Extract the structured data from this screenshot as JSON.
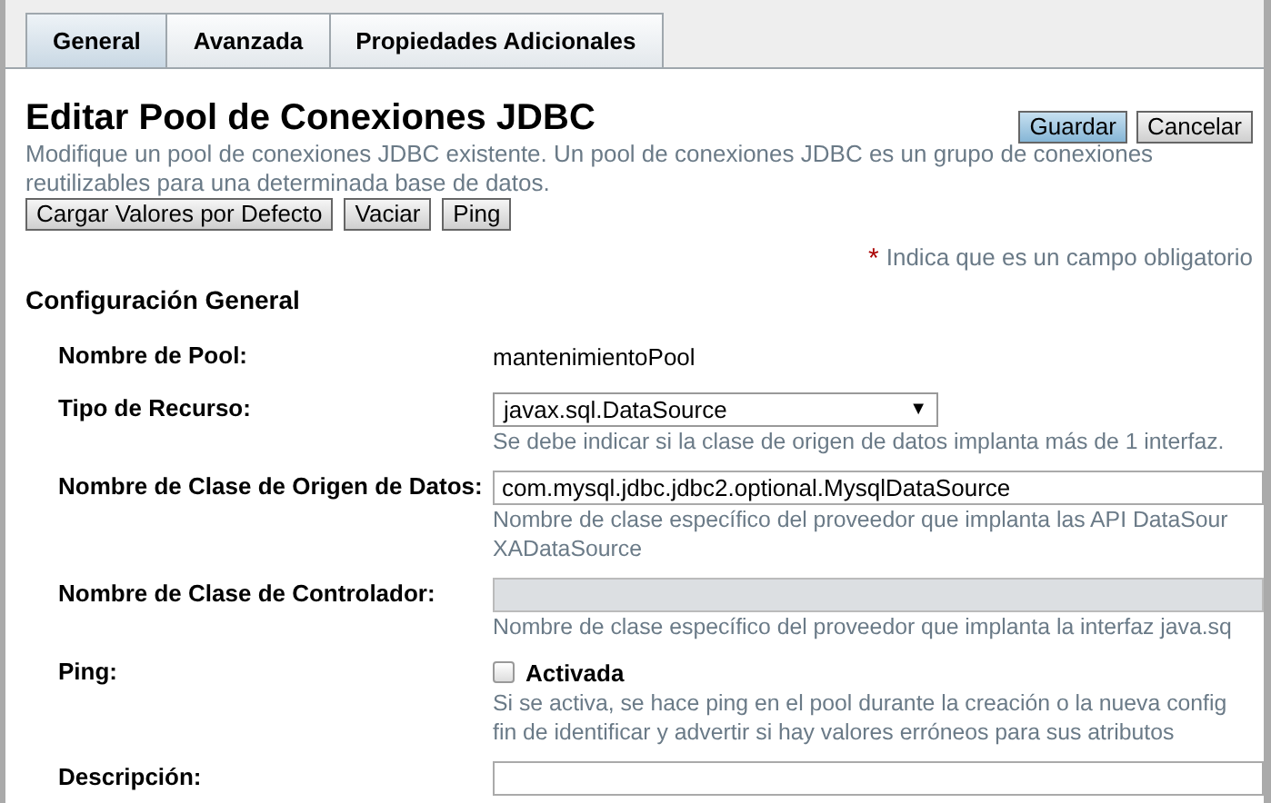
{
  "tabs": [
    {
      "label": "General",
      "selected": true
    },
    {
      "label": "Avanzada",
      "selected": false
    },
    {
      "label": "Propiedades Adicionales",
      "selected": false
    }
  ],
  "title": "Editar Pool de Conexiones JDBC",
  "description_lines": [
    "Modifique un pool de conexiones JDBC existente. Un pool de conexiones JDBC es un grupo de conexiones",
    "reutilizables para una determinada base de datos."
  ],
  "header_buttons": [
    {
      "label": "Guardar",
      "kind": "primary"
    },
    {
      "label": "Cancelar",
      "kind": "normal"
    }
  ],
  "action_buttons": [
    "Cargar Valores por Defecto",
    "Vaciar",
    "Ping"
  ],
  "required_note": {
    "mark": "*",
    "text": "Indica que es un campo obligatorio"
  },
  "section_title": "Configuración General",
  "fields": [
    {
      "kind": "text",
      "label": "Nombre de Pool:",
      "value": "mantenimientoPool"
    },
    {
      "kind": "select",
      "label": "Tipo de Recurso:",
      "value": "javax.sql.DataSource",
      "arrow": "▼",
      "help_lines": [
        "Se debe indicar si la clase de origen de datos implanta más de 1 interfaz."
      ]
    },
    {
      "kind": "input",
      "label": "Nombre de Clase de Origen de Datos:",
      "value": "com.mysql.jdbc.jdbc2.optional.MysqlDataSource",
      "disabled": false,
      "help_lines": [
        "Nombre de clase específico del proveedor que implanta las API DataSour",
        "XADataSource"
      ]
    },
    {
      "kind": "input",
      "label": "Nombre de Clase de Controlador:",
      "disabled": true,
      "help_lines": [
        "Nombre de clase específico del proveedor que implanta la interfaz java.sq"
      ]
    },
    {
      "kind": "checkbox",
      "label": "Ping:",
      "value": "Activada",
      "checked": false,
      "help_lines": [
        "Si se activa, se hace ping en el pool durante la creación o la nueva config",
        "fin de identificar y advertir si hay valores erróneos para sus atributos"
      ]
    },
    {
      "kind": "input",
      "label": "Descripción:",
      "disabled": false
    }
  ]
}
